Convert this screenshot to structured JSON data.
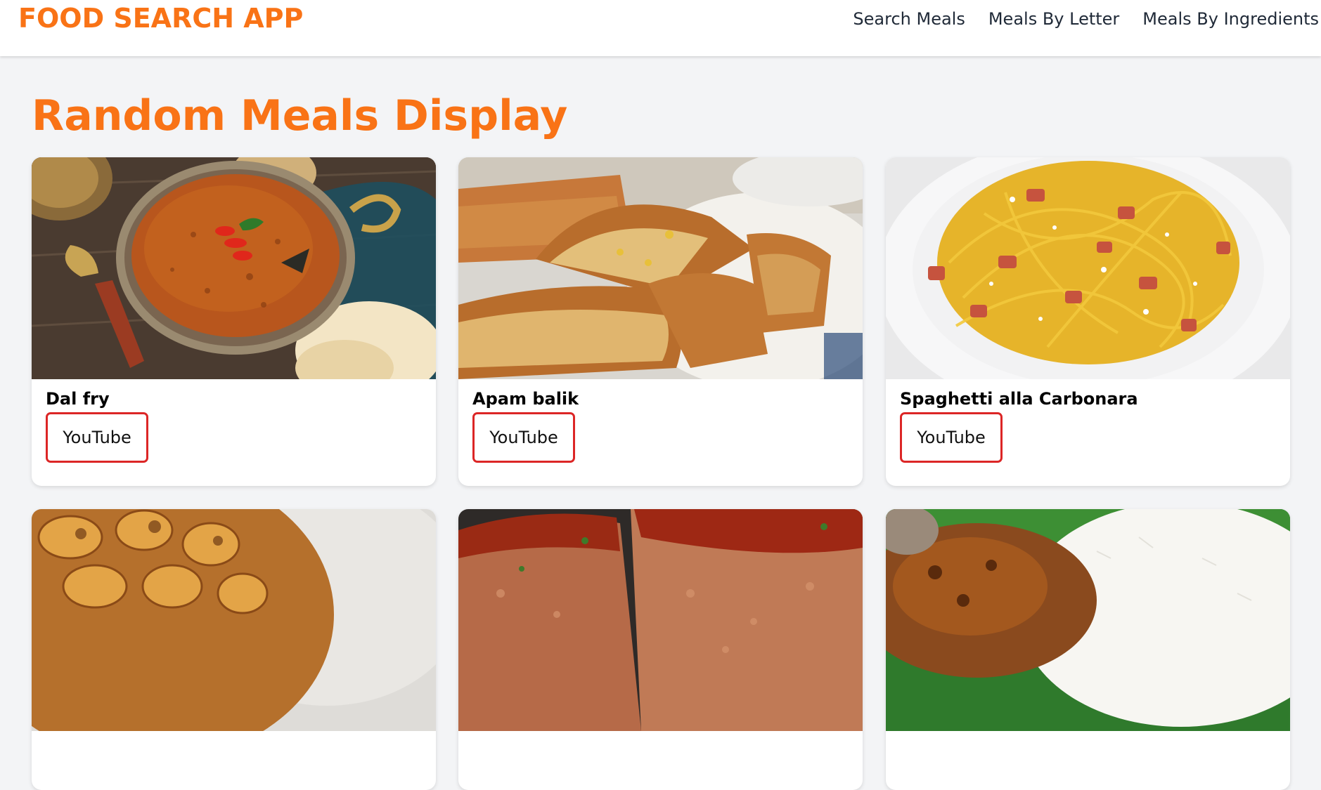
{
  "app": {
    "brand": "FOOD SEARCH APP"
  },
  "nav": {
    "links": [
      "Search Meals",
      "Meals By Letter",
      "Meals By Ingredients"
    ]
  },
  "page": {
    "title": "Random Meals Display"
  },
  "colors": {
    "accent": "#f97316",
    "button_border": "#dc2626",
    "background": "#f3f4f6"
  },
  "meals": [
    {
      "name": "Dal fry",
      "link_label": "YouTube"
    },
    {
      "name": "Apam balik",
      "link_label": "YouTube"
    },
    {
      "name": "Spaghetti alla Carbonara",
      "link_label": "YouTube"
    }
  ]
}
